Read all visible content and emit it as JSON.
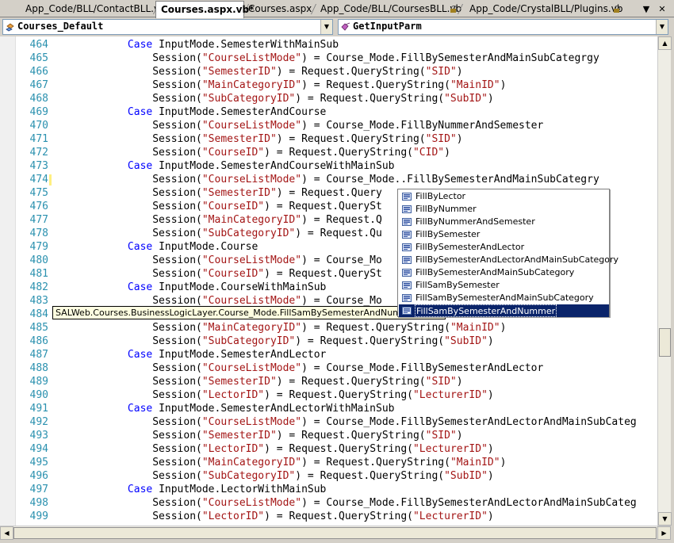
{
  "tabs": [
    {
      "label": "App_Code/BLL/ContactBLL.vb",
      "locked": true
    },
    {
      "label": "Courses.aspx.vb*",
      "active": true
    },
    {
      "label": "Courses.aspx"
    },
    {
      "label": "App_Code/BLL/CoursesBLL.vb",
      "locked": true
    },
    {
      "label": "App_Code/CrystalBLL/Plugins.vb",
      "locked": true
    }
  ],
  "tab_controls": {
    "scroll_icon": "▼",
    "close_icon": "✕"
  },
  "class_combo": {
    "value": "Courses_Default",
    "icon": "class-icon"
  },
  "member_combo": {
    "value": "GetInputParm",
    "icon": "method-icon"
  },
  "code_lines": [
    {
      "n": "464",
      "ind": "            ",
      "segs": [
        [
          "kw",
          "Case"
        ],
        [
          "",
          "InputMode.SemesterWithMainSub"
        ]
      ]
    },
    {
      "n": "465",
      "ind": "                ",
      "segs": [
        [
          "",
          "Session("
        ],
        [
          "str",
          "\"CourseListMode\""
        ],
        [
          "",
          ") = Course_Mode.FillBySemesterAndMainSubCategrgy"
        ]
      ]
    },
    {
      "n": "466",
      "ind": "                ",
      "segs": [
        [
          "",
          "Session("
        ],
        [
          "str",
          "\"SemesterID\""
        ],
        [
          "",
          ") = Request.QueryString("
        ],
        [
          "str",
          "\"SID\""
        ],
        [
          "",
          ")"
        ]
      ]
    },
    {
      "n": "467",
      "ind": "                ",
      "segs": [
        [
          "",
          "Session("
        ],
        [
          "str",
          "\"MainCategoryID\""
        ],
        [
          "",
          ") = Request.QueryString("
        ],
        [
          "str",
          "\"MainID\""
        ],
        [
          "",
          ")"
        ]
      ]
    },
    {
      "n": "468",
      "ind": "                ",
      "segs": [
        [
          "",
          "Session("
        ],
        [
          "str",
          "\"SubCategoryID\""
        ],
        [
          "",
          ") = Request.QueryString("
        ],
        [
          "str",
          "\"SubID\""
        ],
        [
          "",
          ")"
        ]
      ]
    },
    {
      "n": "469",
      "ind": "            ",
      "segs": [
        [
          "kw",
          "Case"
        ],
        [
          "",
          "InputMode.SemesterAndCourse"
        ]
      ]
    },
    {
      "n": "470",
      "ind": "                ",
      "segs": [
        [
          "",
          "Session("
        ],
        [
          "str",
          "\"CourseListMode\""
        ],
        [
          "",
          ") = Course_Mode.FillByNummerAndSemester"
        ]
      ]
    },
    {
      "n": "471",
      "ind": "                ",
      "segs": [
        [
          "",
          "Session("
        ],
        [
          "str",
          "\"SemesterID\""
        ],
        [
          "",
          ") = Request.QueryString("
        ],
        [
          "str",
          "\"SID\""
        ],
        [
          "",
          ")"
        ]
      ]
    },
    {
      "n": "472",
      "ind": "                ",
      "segs": [
        [
          "",
          "Session("
        ],
        [
          "str",
          "\"CourseID\""
        ],
        [
          "",
          ") = Request.QueryString("
        ],
        [
          "str",
          "\"CID\""
        ],
        [
          "",
          ")"
        ]
      ]
    },
    {
      "n": "473",
      "ind": "            ",
      "segs": [
        [
          "kw",
          "Case"
        ],
        [
          "",
          "InputMode.SemesterAndCourseWithMainSub"
        ]
      ]
    },
    {
      "n": "474",
      "ind": "                ",
      "segs": [
        [
          "",
          "Session("
        ],
        [
          "str",
          "\"CourseListMode\""
        ],
        [
          "",
          ") = Course_Mode..FillBySemesterAndMainSubCategry"
        ]
      ]
    },
    {
      "n": "475",
      "ind": "                ",
      "segs": [
        [
          "",
          "Session("
        ],
        [
          "str",
          "\"SemesterID\""
        ],
        [
          "",
          ") = Request.Query"
        ]
      ]
    },
    {
      "n": "476",
      "ind": "                ",
      "segs": [
        [
          "",
          "Session("
        ],
        [
          "str",
          "\"CourseID\""
        ],
        [
          "",
          ") = Request.QuerySt"
        ]
      ]
    },
    {
      "n": "477",
      "ind": "                ",
      "segs": [
        [
          "",
          "Session("
        ],
        [
          "str",
          "\"MainCategoryID\""
        ],
        [
          "",
          ") = Request.Q"
        ]
      ]
    },
    {
      "n": "478",
      "ind": "                ",
      "segs": [
        [
          "",
          "Session("
        ],
        [
          "str",
          "\"SubCategoryID\""
        ],
        [
          "",
          ") = Request.Qu"
        ]
      ]
    },
    {
      "n": "479",
      "ind": "            ",
      "segs": [
        [
          "kw",
          "Case"
        ],
        [
          "",
          "InputMode.Course"
        ]
      ]
    },
    {
      "n": "480",
      "ind": "                ",
      "segs": [
        [
          "",
          "Session("
        ],
        [
          "str",
          "\"CourseListMode\""
        ],
        [
          "",
          ") = Course_Mo"
        ]
      ]
    },
    {
      "n": "481",
      "ind": "                ",
      "segs": [
        [
          "",
          "Session("
        ],
        [
          "str",
          "\"CourseID\""
        ],
        [
          "",
          ") = Request.QuerySt"
        ]
      ]
    },
    {
      "n": "482",
      "ind": "            ",
      "segs": [
        [
          "kw",
          "Case"
        ],
        [
          "",
          "InputMode.CourseWithMainSub"
        ]
      ]
    },
    {
      "n": "483",
      "ind": "                ",
      "segs": [
        [
          "",
          "Session("
        ],
        [
          "str",
          "\"CourseListMode\""
        ],
        [
          "",
          ") = Course_Mo"
        ]
      ]
    },
    {
      "n": "484",
      "ind": "                ",
      "segs": [
        [
          "",
          ""
        ]
      ]
    },
    {
      "n": "485",
      "ind": "                ",
      "segs": [
        [
          "",
          "Session("
        ],
        [
          "str",
          "\"MainCategoryID\""
        ],
        [
          "",
          ") = Request.QueryString("
        ],
        [
          "str",
          "\"MainID\""
        ],
        [
          "",
          ")"
        ]
      ]
    },
    {
      "n": "486",
      "ind": "                ",
      "segs": [
        [
          "",
          "Session("
        ],
        [
          "str",
          "\"SubCategoryID\""
        ],
        [
          "",
          ") = Request.QueryString("
        ],
        [
          "str",
          "\"SubID\""
        ],
        [
          "",
          ")"
        ]
      ]
    },
    {
      "n": "487",
      "ind": "            ",
      "segs": [
        [
          "kw",
          "Case"
        ],
        [
          "",
          "InputMode.SemesterAndLector"
        ]
      ]
    },
    {
      "n": "488",
      "ind": "                ",
      "segs": [
        [
          "",
          "Session("
        ],
        [
          "str",
          "\"CourseListMode\""
        ],
        [
          "",
          ") = Course_Mode.FillBySemesterAndLector"
        ]
      ]
    },
    {
      "n": "489",
      "ind": "                ",
      "segs": [
        [
          "",
          "Session("
        ],
        [
          "str",
          "\"SemesterID\""
        ],
        [
          "",
          ") = Request.QueryString("
        ],
        [
          "str",
          "\"SID\""
        ],
        [
          "",
          ")"
        ]
      ]
    },
    {
      "n": "490",
      "ind": "                ",
      "segs": [
        [
          "",
          "Session("
        ],
        [
          "str",
          "\"LectorID\""
        ],
        [
          "",
          ") = Request.QueryString("
        ],
        [
          "str",
          "\"LecturerID\""
        ],
        [
          "",
          ")"
        ]
      ]
    },
    {
      "n": "491",
      "ind": "            ",
      "segs": [
        [
          "kw",
          "Case"
        ],
        [
          "",
          "InputMode.SemesterAndLectorWithMainSub"
        ]
      ]
    },
    {
      "n": "492",
      "ind": "                ",
      "segs": [
        [
          "",
          "Session("
        ],
        [
          "str",
          "\"CourseListMode\""
        ],
        [
          "",
          ") = Course_Mode.FillBySemesterAndLectorAndMainSubCateg"
        ]
      ]
    },
    {
      "n": "493",
      "ind": "                ",
      "segs": [
        [
          "",
          "Session("
        ],
        [
          "str",
          "\"SemesterID\""
        ],
        [
          "",
          ") = Request.QueryString("
        ],
        [
          "str",
          "\"SID\""
        ],
        [
          "",
          ")"
        ]
      ]
    },
    {
      "n": "494",
      "ind": "                ",
      "segs": [
        [
          "",
          "Session("
        ],
        [
          "str",
          "\"LectorID\""
        ],
        [
          "",
          ") = Request.QueryString("
        ],
        [
          "str",
          "\"LecturerID\""
        ],
        [
          "",
          ")"
        ]
      ]
    },
    {
      "n": "495",
      "ind": "                ",
      "segs": [
        [
          "",
          "Session("
        ],
        [
          "str",
          "\"MainCategoryID\""
        ],
        [
          "",
          ") = Request.QueryString("
        ],
        [
          "str",
          "\"MainID\""
        ],
        [
          "",
          ")"
        ]
      ]
    },
    {
      "n": "496",
      "ind": "                ",
      "segs": [
        [
          "",
          "Session("
        ],
        [
          "str",
          "\"SubCategoryID\""
        ],
        [
          "",
          ") = Request.QueryString("
        ],
        [
          "str",
          "\"SubID\""
        ],
        [
          "",
          ")"
        ]
      ]
    },
    {
      "n": "497",
      "ind": "            ",
      "segs": [
        [
          "kw",
          "Case"
        ],
        [
          "",
          "InputMode.LectorWithMainSub"
        ]
      ]
    },
    {
      "n": "498",
      "ind": "                ",
      "segs": [
        [
          "",
          "Session("
        ],
        [
          "str",
          "\"CourseListMode\""
        ],
        [
          "",
          ") = Course_Mode.FillBySemesterAndLectorAndMainSubCateg"
        ]
      ]
    },
    {
      "n": "499",
      "ind": "                ",
      "segs": [
        [
          "",
          "Session("
        ],
        [
          "str",
          "\"LectorID\""
        ],
        [
          "",
          ") = Request.QueryString("
        ],
        [
          "str",
          "\"LecturerID\""
        ],
        [
          "",
          ")"
        ]
      ]
    }
  ],
  "tooltip": "SALWeb.Courses.BusinessLogicLayer.Course_Mode.FillSamBySemesterAndNummer = 10",
  "intellisense": {
    "items": [
      "FillByLector",
      "FillByNummer",
      "FillByNummerAndSemester",
      "FillBySemester",
      "FillBySemesterAndLector",
      "FillBySemesterAndLectorAndMainSubCategory",
      "FillBySemesterAndMainSubCategory",
      "FillSamBySemester",
      "FillSamBySemesterAndMainSubCategory",
      "FillSamBySemesterAndNummer"
    ],
    "selected_index": 9,
    "item_icon": "enum-member-icon"
  },
  "scrollbar": {
    "up": "▲",
    "down": "▼",
    "left": "◀",
    "right": "▶"
  },
  "colors": {
    "keyword": "#0000ff",
    "string": "#a31515",
    "line_number": "#2b91af",
    "selection": "#0a246a"
  }
}
